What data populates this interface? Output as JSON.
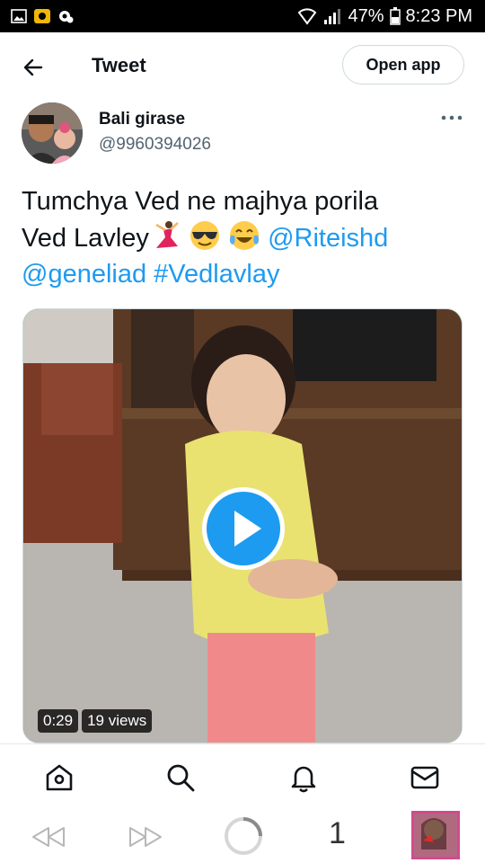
{
  "status_bar": {
    "battery": "47%",
    "time": "8:23 PM"
  },
  "header": {
    "title": "Tweet",
    "open_app_label": "Open app"
  },
  "author": {
    "name": "Bali girase",
    "handle": "@9960394026"
  },
  "tweet": {
    "line1": "Tumchya Ved ne majhya porila",
    "line2_text": "Ved Lavley",
    "emojis": [
      "dancer-emoji",
      "sunglasses-emoji",
      "tears-of-joy-emoji"
    ],
    "mention1": "@Riteishd",
    "mention2": "@geneliad",
    "hashtag": "#Vedlavlay"
  },
  "video": {
    "duration": "0:29",
    "views": "19 views"
  },
  "bottom_nav": {
    "items": [
      "home-icon",
      "search-icon",
      "notifications-icon",
      "messages-icon"
    ]
  },
  "browser_bar": {
    "tab_count": "1"
  },
  "colors": {
    "link": "#1d9bf0",
    "play_button": "#1d9bf0",
    "handle_gray": "#536471"
  }
}
